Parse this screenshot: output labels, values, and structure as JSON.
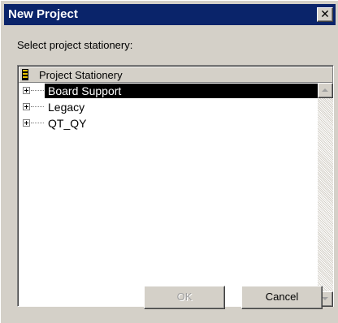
{
  "window": {
    "title": "New Project",
    "close_glyph": "✕"
  },
  "prompt": "Select project stationery:",
  "tree": {
    "header_icon": "stationery-stack-icon",
    "header_label": "Project Stationery",
    "items": [
      {
        "label": "Board Support",
        "selected": true,
        "expander_icon": "plus-expander-icon"
      },
      {
        "label": "Legacy",
        "selected": false,
        "expander_icon": "plus-expander-icon"
      },
      {
        "label": "QT_QY",
        "selected": false,
        "expander_icon": "plus-expander-icon"
      }
    ]
  },
  "buttons": {
    "ok_label": "OK",
    "ok_enabled": false,
    "cancel_label": "Cancel"
  },
  "colors": {
    "titlebar": "#0a246a",
    "face": "#d4d0c8",
    "selection": "#000000"
  }
}
